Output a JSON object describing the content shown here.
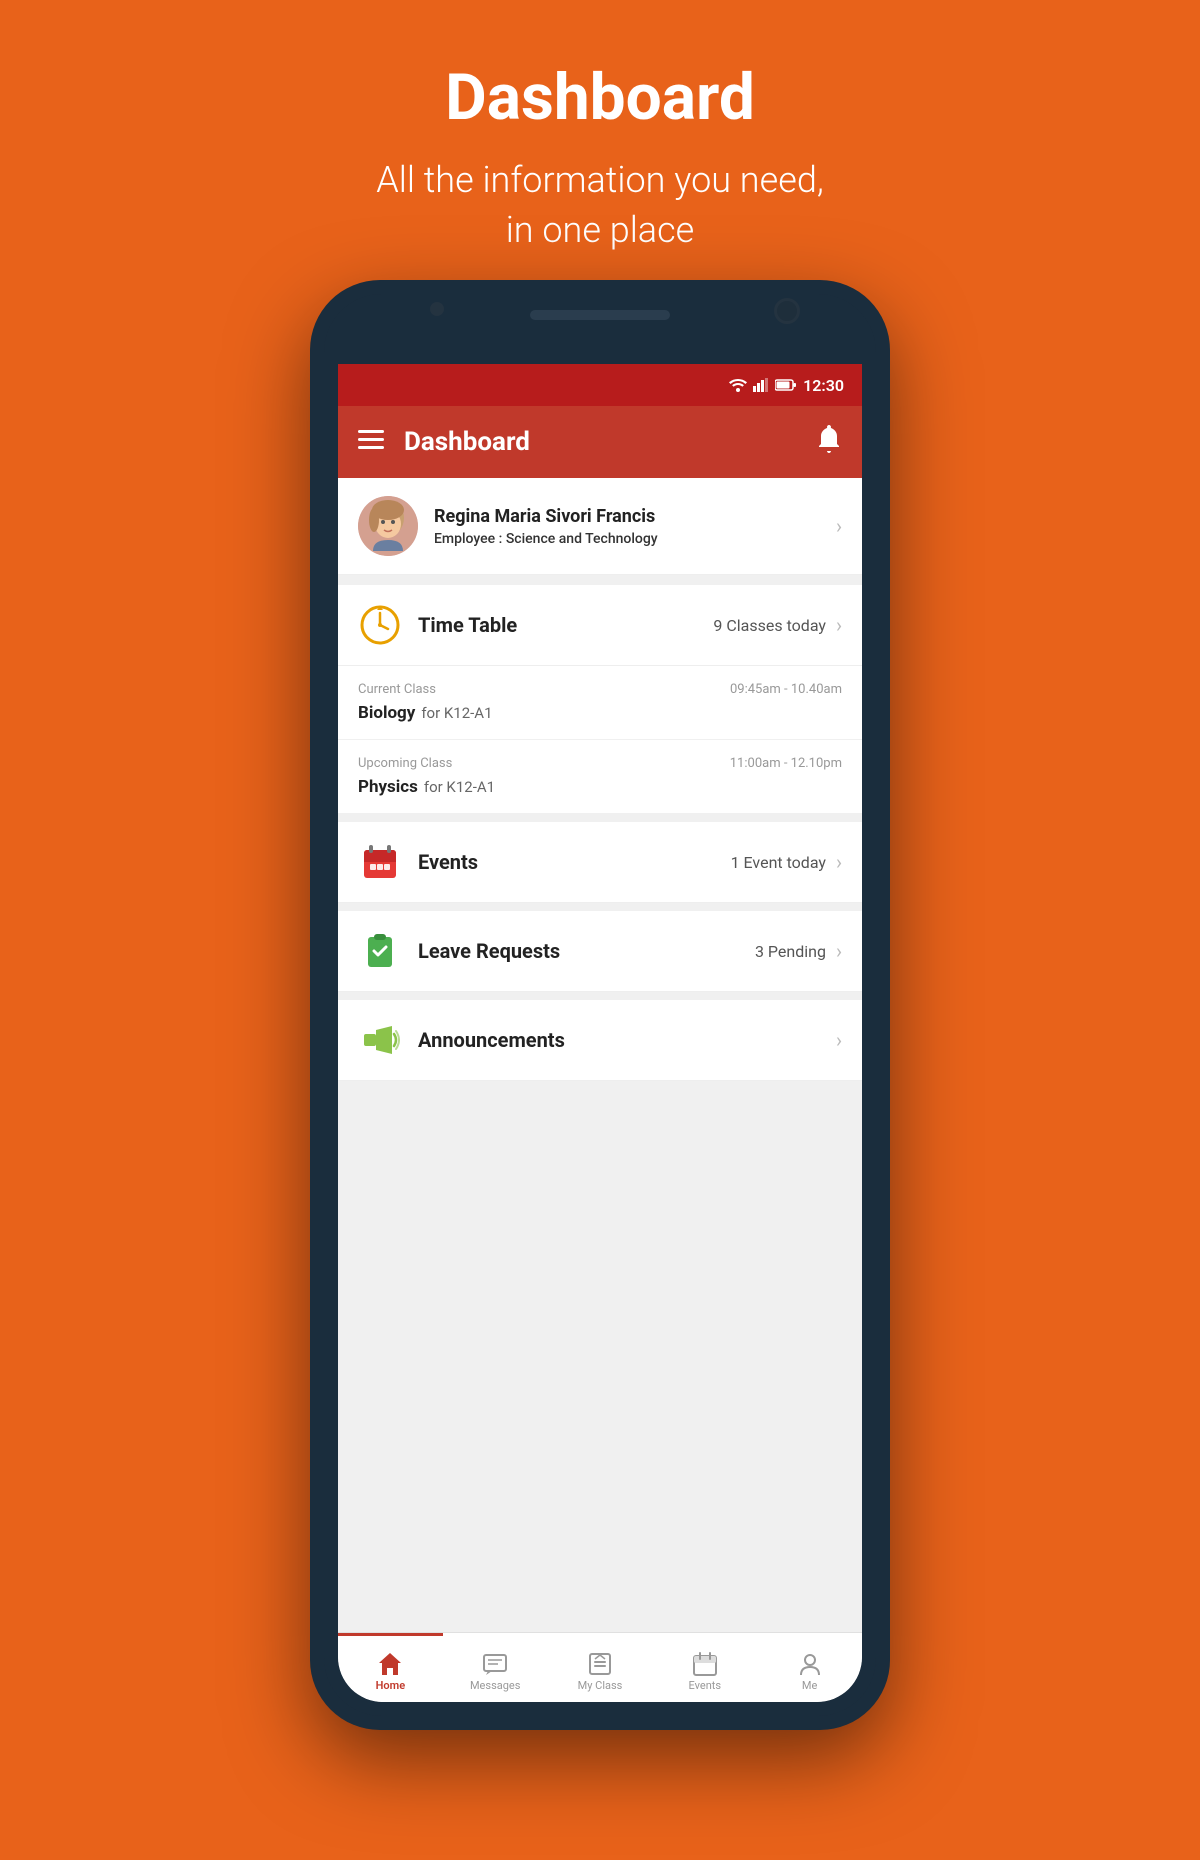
{
  "page": {
    "title": "Dashboard",
    "subtitle_line1": "All the information you need,",
    "subtitle_line2": "in one place"
  },
  "status_bar": {
    "time": "12:30"
  },
  "top_bar": {
    "title": "Dashboard"
  },
  "profile": {
    "name": "Regina Maria Sivori Francis",
    "role_label": "Employee : ",
    "role_value": "Science and Technology"
  },
  "timetable": {
    "icon": "🕐",
    "title": "Time Table",
    "badge": "9 Classes today",
    "current_class": {
      "label": "Current Class",
      "time": "09:45am - 10.40am",
      "subject": "Biology",
      "group": "for K12-A1"
    },
    "upcoming_class": {
      "label": "Upcoming Class",
      "time": "11:00am - 12.10pm",
      "subject": "Physics",
      "group": "for K12-A1"
    }
  },
  "events": {
    "icon": "📅",
    "title": "Events",
    "badge": "1 Event today"
  },
  "leave_requests": {
    "icon": "✅",
    "title": "Leave Requests",
    "badge": "3 Pending"
  },
  "announcements": {
    "icon": "📢",
    "title": "Announcements",
    "badge": ""
  },
  "bottom_nav": {
    "items": [
      {
        "id": "home",
        "label": "Home",
        "active": true
      },
      {
        "id": "messages",
        "label": "Messages",
        "active": false
      },
      {
        "id": "my-class",
        "label": "My Class",
        "active": false
      },
      {
        "id": "events",
        "label": "Events",
        "active": false
      },
      {
        "id": "me",
        "label": "Me",
        "active": false
      }
    ]
  },
  "colors": {
    "primary": "#c0392b",
    "status_bar": "#b71c1c",
    "orange_bg": "#E8621A"
  }
}
